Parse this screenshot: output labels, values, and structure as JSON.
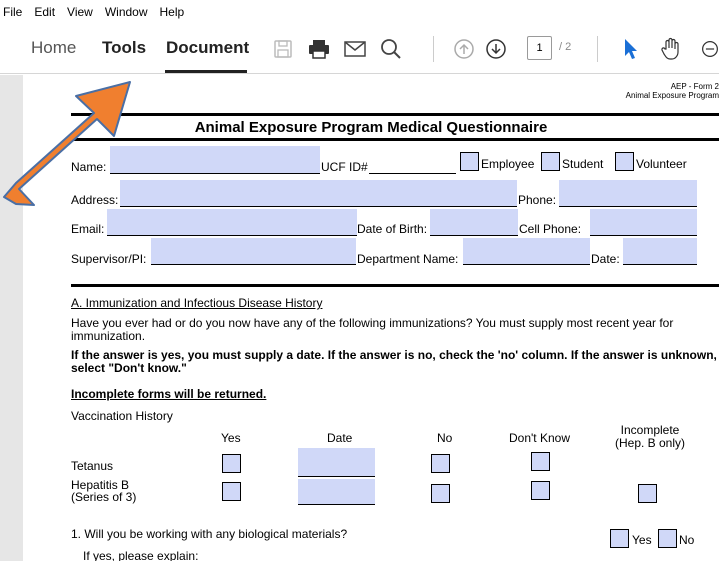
{
  "menubar": {
    "items": [
      "File",
      "Edit",
      "View",
      "Window",
      "Help"
    ]
  },
  "toolbar": {
    "tabs": [
      "Home",
      "Tools",
      "Document"
    ],
    "current_page": "1",
    "total_pages": "/ 2"
  },
  "form": {
    "form_id_line1": "AEP - Form 2",
    "form_id_line2": "Animal Exposure Program",
    "title": "Animal Exposure Program Medical Questionnaire",
    "name_label": "Name:",
    "ucf_label": "UCF ID#",
    "employee_label": "Employee",
    "student_label": "Student",
    "volunteer_label": "Volunteer",
    "address_label": "Address:",
    "phone_label": "Phone:",
    "email_label": "Email:",
    "dob_label": "Date of Birth:",
    "cell_label": "Cell Phone:",
    "supervisor_label": "Supervisor/PI:",
    "dept_label": "Department Name:",
    "date_label": "Date:",
    "section_a": "A. Immunization and Infectious Disease History",
    "para1": "Have you ever had or do you now have any of the following immunizations? You must supply most recent year for immunization.",
    "para2": "If the answer is yes, you must supply a date. If the answer is no, check the 'no' column. If the answer is unknown, select \"Don't know.\"",
    "para3": "Incomplete forms will be returned.",
    "vacc_history": "Vaccination History",
    "col_yes": "Yes",
    "col_date": "Date",
    "col_no": "No",
    "col_dontknow": "Don't Know",
    "col_incomplete_1": "Incomplete",
    "col_incomplete_2": "(Hep. B only)",
    "row_tetanus": "Tetanus",
    "row_hepb_1": "Hepatitis B",
    "row_hepb_2": "(Series of 3)",
    "q1": "1. Will you be working with any biological materials?",
    "q1_yes": "Yes",
    "q1_no": "No",
    "q1_explain": "If yes, please explain:"
  },
  "colors": {
    "field_fill": "#d0d8f8",
    "arrow_fill": "#f07f2f",
    "arrow_stroke": "#4a6fa5"
  }
}
